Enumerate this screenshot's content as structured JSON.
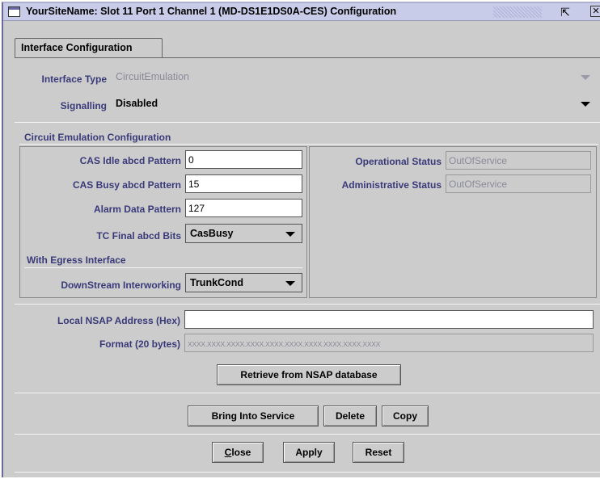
{
  "window": {
    "title": "YourSiteName: Slot 11 Port 1 Channel 1 (MD-DS1E1DS0A-CES) Configuration",
    "icons": [
      "window-icon",
      "restore-icon",
      "close-icon"
    ]
  },
  "tabs": [
    {
      "label": "Interface Configuration",
      "selected": true
    }
  ],
  "interface": {
    "type_label": "Interface Type",
    "type_value": "CircuitEmulation",
    "signalling_label": "Signalling",
    "signalling_value": "Disabled"
  },
  "ces": {
    "section_title": "Circuit Emulation Configuration",
    "cas_idle_label": "CAS Idle abcd Pattern",
    "cas_idle_value": "0",
    "cas_busy_label": "CAS Busy abcd Pattern",
    "cas_busy_value": "15",
    "alarm_label": "Alarm Data Pattern",
    "alarm_value": "127",
    "tc_final_label": "TC Final abcd Bits",
    "tc_final_value": "CasBusy",
    "egress_title": "With Egress Interface",
    "downstream_label": "DownStream Interworking",
    "downstream_value": "TrunkCond",
    "op_status_label": "Operational Status",
    "op_status_value": "OutOfService",
    "admin_status_label": "Administrative Status",
    "admin_status_value": "OutOfService"
  },
  "nsap": {
    "address_label": "Local NSAP Address (Hex)",
    "address_value": "",
    "format_label": "Format (20 bytes)",
    "format_value": "XXXX.XXXX.XXXX.XXXX.XXXX.XXXX.XXXX.XXXX.XXXX.XXXX",
    "retrieve_label": "Retrieve from NSAP database"
  },
  "actions": {
    "bring_into_service": "Bring Into Service",
    "delete": "Delete",
    "copy": "Copy"
  },
  "footer": {
    "close_mnemonic": "C",
    "close_rest": "lose",
    "apply": "Apply",
    "reset": "Reset"
  },
  "colors": {
    "window_bg": "#cccccc",
    "titlebar_bg": "#c8cce8",
    "label_blue": "#3a3a7a",
    "disabled_text": "#8a8a9a"
  }
}
